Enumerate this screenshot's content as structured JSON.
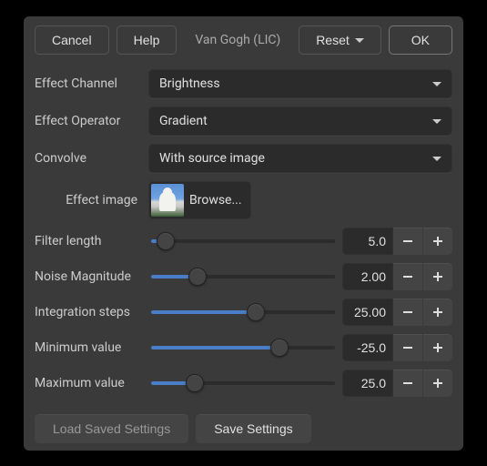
{
  "dialog_title": "Van Gogh (LIC)",
  "header": {
    "cancel": "Cancel",
    "help": "Help",
    "reset": "Reset",
    "ok": "OK"
  },
  "fields": {
    "effect_channel": {
      "label": "Effect Channel",
      "value": "Brightness"
    },
    "effect_operator": {
      "label": "Effect Operator",
      "value": "Gradient"
    },
    "convolve": {
      "label": "Convolve",
      "value": "With source image"
    },
    "effect_image": {
      "label": "Effect image",
      "browse": "Browse..."
    }
  },
  "sliders": [
    {
      "label": "Filter length",
      "value": "5.0",
      "percent": 8
    },
    {
      "label": "Noise Magnitude",
      "value": "2.00",
      "percent": 25
    },
    {
      "label": "Integration steps",
      "value": "25.00",
      "percent": 57
    },
    {
      "label": "Minimum value",
      "value": "-25.0",
      "percent": 70
    },
    {
      "label": "Maximum value",
      "value": "25.0",
      "percent": 24
    }
  ],
  "footer": {
    "load": "Load Saved Settings",
    "save": "Save Settings"
  }
}
